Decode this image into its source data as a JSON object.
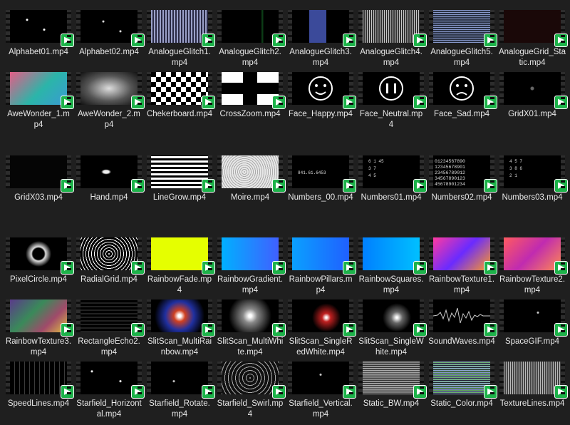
{
  "badge_icon": "play-badge-icon",
  "accent_color": "#1db34a",
  "files": [
    {
      "name": "Alphabet01.mp4",
      "preview": "alphabet"
    },
    {
      "name": "Alphabet02.mp4",
      "preview": "dots"
    },
    {
      "name": "AnalogueGlitch1.mp4",
      "preview": "glitch1"
    },
    {
      "name": "AnalogueGlitch2.mp4",
      "preview": "dark"
    },
    {
      "name": "AnalogueGlitch3.mp4",
      "preview": "glitchblue"
    },
    {
      "name": "AnalogueGlitch4.mp4",
      "preview": "glitch4"
    },
    {
      "name": "AnalogueGlitch5.mp4",
      "preview": "glitch5"
    },
    {
      "name": "AnalogueGrid_Static.mp4",
      "preview": "darkred"
    },
    {
      "name": "AweWonder_1.mp4",
      "preview": "awe1"
    },
    {
      "name": "AweWonder_2.mp4",
      "preview": "awe2"
    },
    {
      "name": "Chekerboard.mp4",
      "preview": "checker"
    },
    {
      "name": "CrossZoom.mp4",
      "preview": "cross"
    },
    {
      "name": "Face_Happy.mp4",
      "preview": "face_happy"
    },
    {
      "name": "Face_Neutral.mp4",
      "preview": "face_neutral"
    },
    {
      "name": "Face_Sad.mp4",
      "preview": "face_sad"
    },
    {
      "name": "GridX01.mp4",
      "preview": "gridx"
    },
    {
      "name": "GridX03.mp4",
      "preview": "gridx3"
    },
    {
      "name": "Hand.mp4",
      "preview": "hand"
    },
    {
      "name": "LineGrow.mp4",
      "preview": "lines"
    },
    {
      "name": "Moire.mp4",
      "preview": "moire"
    },
    {
      "name": "Numbers_00.mp4",
      "preview": "num00"
    },
    {
      "name": "Numbers01.mp4",
      "preview": "num01"
    },
    {
      "name": "Numbers02.mp4",
      "preview": "num02"
    },
    {
      "name": "Numbers03.mp4",
      "preview": "num03"
    },
    {
      "name": "PixelCircle.mp4",
      "preview": "pixelcircle"
    },
    {
      "name": "RadialGrid.mp4",
      "preview": "radial"
    },
    {
      "name": "RainbowFade.mp4",
      "preview": "yellow"
    },
    {
      "name": "RainbowGradient.mp4",
      "preview": "gradblue"
    },
    {
      "name": "RainbowPillars.mp4",
      "preview": "pillars"
    },
    {
      "name": "RainbowSquares.mp4",
      "preview": "squares"
    },
    {
      "name": "RainbowTexture1.mp4",
      "preview": "tex1"
    },
    {
      "name": "RainbowTexture2.mp4",
      "preview": "tex2"
    },
    {
      "name": "RainbowTexture3.mp4",
      "preview": "tex3"
    },
    {
      "name": "RectangleEcho2.mp4",
      "preview": "recho"
    },
    {
      "name": "SlitScan_MultiRainbow.mp4",
      "preview": "slitrainbow"
    },
    {
      "name": "SlitScan_MultiWhite.mp4",
      "preview": "slitwhite"
    },
    {
      "name": "SlitScan_SingleRedWhite.mp4",
      "preview": "slitred"
    },
    {
      "name": "SlitScan_SingleWhite.mp4",
      "preview": "slitsingle"
    },
    {
      "name": "SoundWaves.mp4",
      "preview": "wave"
    },
    {
      "name": "SpaceGIF.mp4",
      "preview": "space"
    },
    {
      "name": "SpeedLines.mp4",
      "preview": "speed"
    },
    {
      "name": "Starfield_Horizontal.mp4",
      "preview": "stars"
    },
    {
      "name": "Starfield_Rotate.mp4",
      "preview": "stars2"
    },
    {
      "name": "Starfield_Swirl.mp4",
      "preview": "swirl"
    },
    {
      "name": "Starfield_Vertical.mp4",
      "preview": "stars3"
    },
    {
      "name": "Static_BW.mp4",
      "preview": "staticbw"
    },
    {
      "name": "Static_Color.mp4",
      "preview": "staticcolor"
    },
    {
      "name": "TextureLines.mp4",
      "preview": "texlines"
    }
  ]
}
